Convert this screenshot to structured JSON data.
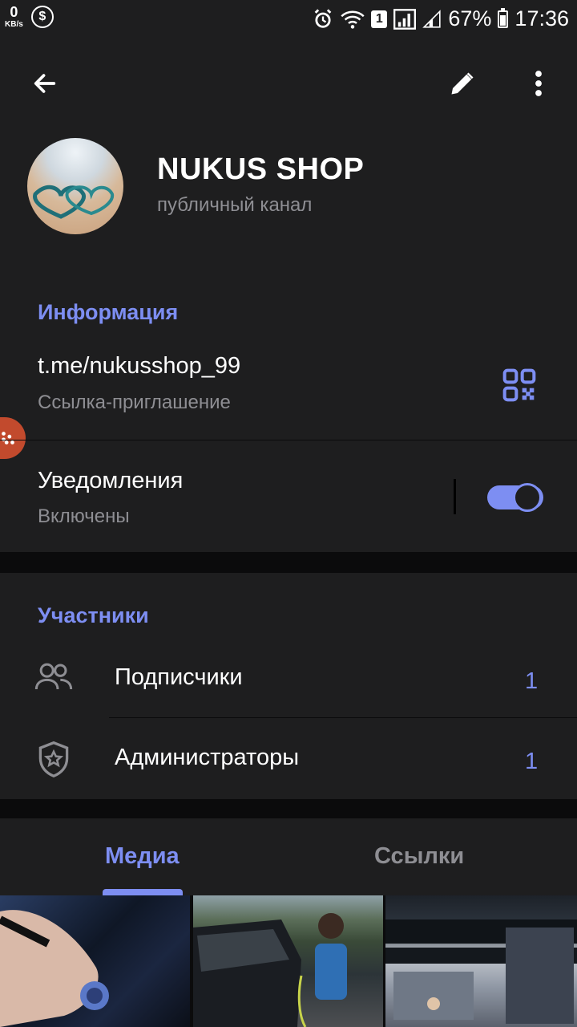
{
  "status_bar": {
    "kbs_value": "0",
    "kbs_unit": "KB/s",
    "dollar_icon": "$",
    "sim_badge": "1",
    "battery_percent": "67%",
    "time": "17:36"
  },
  "header": {
    "channel_name": "NUKUS SHOP",
    "channel_type": "публичный канал"
  },
  "info": {
    "section_title": "Информация",
    "link": "t.me/nukusshop_99",
    "link_caption": "Ссылка-приглашение",
    "notifications_title": "Уведомления",
    "notifications_status": "Включены",
    "notifications_enabled": true
  },
  "members": {
    "section_title": "Участники",
    "items": [
      {
        "label": "Подписчики",
        "count": "1",
        "icon": "users-icon"
      },
      {
        "label": "Администраторы",
        "count": "1",
        "icon": "shield-star-icon"
      }
    ]
  },
  "tabs": [
    {
      "label": "Медиа",
      "active": true
    },
    {
      "label": "Ссылки",
      "active": false
    }
  ],
  "colors": {
    "accent": "#7d8ef2",
    "surface": "#1e1e1f",
    "background": "#0b0b0c",
    "secondary_text": "#8e8e93"
  }
}
